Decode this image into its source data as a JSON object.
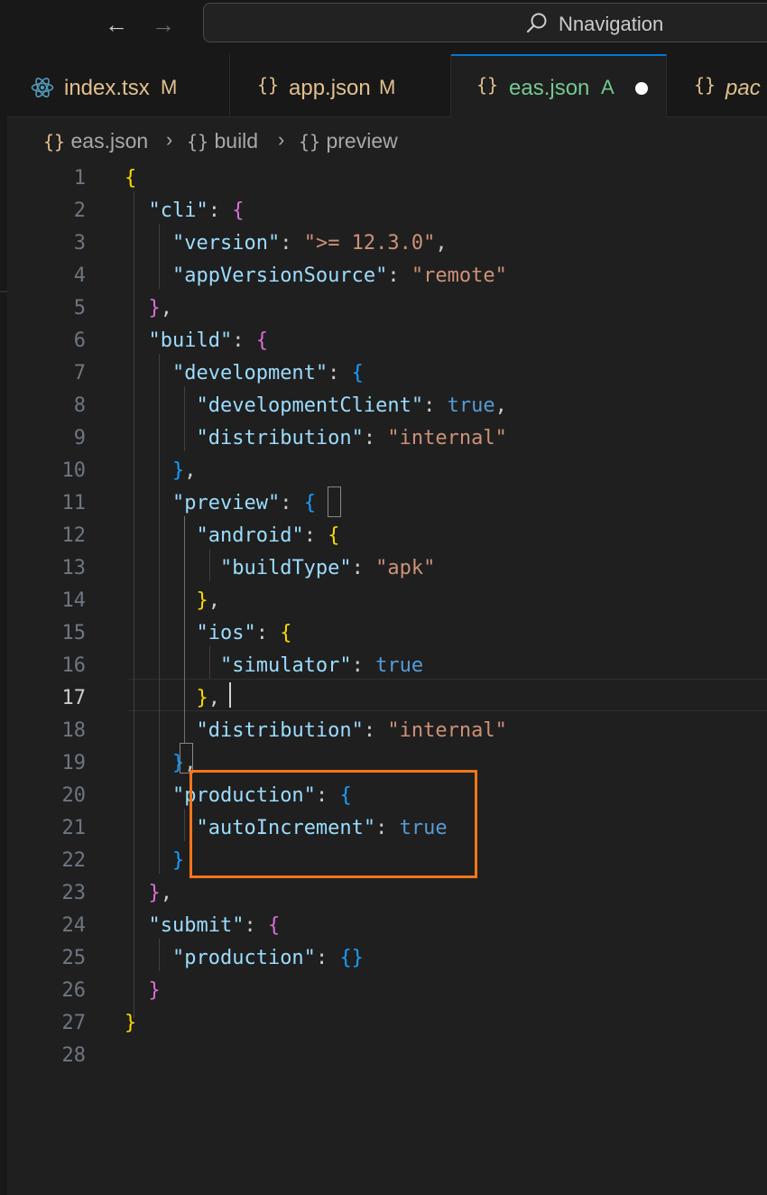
{
  "titlebar": {
    "back_icon": "arrow-left-icon",
    "forward_icon": "arrow-right-icon",
    "search_text": "Nnavigation"
  },
  "tabs": [
    {
      "icon": "react-icon",
      "name": "index.tsx",
      "status": "M"
    },
    {
      "icon": "json-braces-icon",
      "name": "app.json",
      "status": "M"
    },
    {
      "icon": "json-braces-icon",
      "name": "eas.json",
      "status": "A",
      "active": true,
      "dirty": true
    },
    {
      "icon": "json-braces-icon",
      "name": "package.json",
      "visible_name": "pac"
    }
  ],
  "breadcrumb": {
    "items": [
      {
        "icon": "{}",
        "label": "eas.json"
      },
      {
        "icon": "{}",
        "label": "build"
      },
      {
        "icon": "{}",
        "label": "preview"
      }
    ]
  },
  "editor": {
    "current_line": 17,
    "lines": [
      {
        "n": "1"
      },
      {
        "n": "2"
      },
      {
        "n": "3"
      },
      {
        "n": "4"
      },
      {
        "n": "5"
      },
      {
        "n": "6"
      },
      {
        "n": "7"
      },
      {
        "n": "8"
      },
      {
        "n": "9"
      },
      {
        "n": "10"
      },
      {
        "n": "11"
      },
      {
        "n": "12"
      },
      {
        "n": "13"
      },
      {
        "n": "14"
      },
      {
        "n": "15"
      },
      {
        "n": "16"
      },
      {
        "n": "17"
      },
      {
        "n": "18"
      },
      {
        "n": "19"
      },
      {
        "n": "20"
      },
      {
        "n": "21"
      },
      {
        "n": "22"
      },
      {
        "n": "23"
      },
      {
        "n": "24"
      },
      {
        "n": "25"
      },
      {
        "n": "26"
      },
      {
        "n": "27"
      },
      {
        "n": "28"
      }
    ],
    "tokens": {
      "cli": "\"cli\"",
      "version_key": "\"version\"",
      "version_val": "\">= 12.3.0\"",
      "appVersionSource_key": "\"appVersionSource\"",
      "appVersionSource_val": "\"remote\"",
      "build": "\"build\"",
      "development": "\"development\"",
      "developmentClient_key": "\"developmentClient\"",
      "true": "true",
      "distribution_key": "\"distribution\"",
      "internal": "\"internal\"",
      "preview": "\"preview\"",
      "android": "\"android\"",
      "buildType_key": "\"buildType\"",
      "apk": "\"apk\"",
      "ios": "\"ios\"",
      "simulator_key": "\"simulator\"",
      "production": "\"production\"",
      "autoIncrement_key": "\"autoIncrement\"",
      "submit": "\"submit\""
    }
  },
  "annotation": {
    "color": "#f5761a"
  },
  "colors": {
    "background": "#1f1f1f",
    "key": "#9cdcfe",
    "string": "#ce9178",
    "boolean": "#569cd6",
    "bracket_gold": "#ffd700",
    "bracket_purple": "#da70d6",
    "bracket_blue": "#179fff"
  }
}
